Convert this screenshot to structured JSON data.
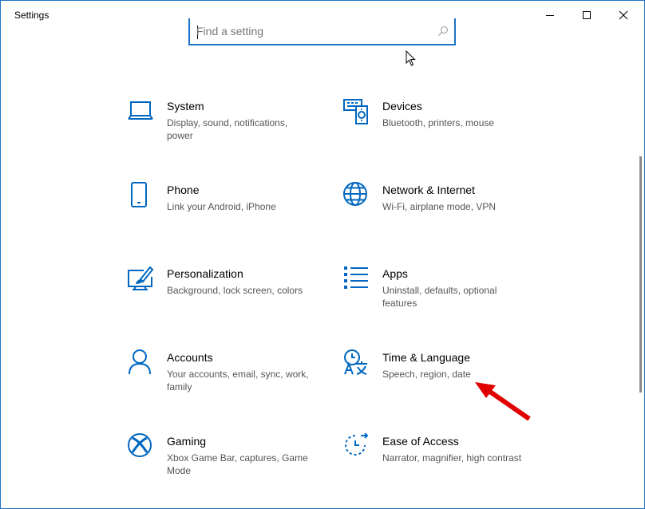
{
  "window": {
    "title": "Settings",
    "controls": {
      "minimize": "minimize",
      "maximize": "maximize",
      "close": "close"
    }
  },
  "search": {
    "placeholder": "Find a setting",
    "value": ""
  },
  "accent_color": "#0067c0",
  "annotation_color": "#e00000",
  "tiles": [
    {
      "title": "System",
      "description": "Display, sound, notifications, power",
      "icon": "laptop-icon"
    },
    {
      "title": "Devices",
      "description": "Bluetooth, printers, mouse",
      "icon": "devices-icon"
    },
    {
      "title": "Phone",
      "description": "Link your Android, iPhone",
      "icon": "phone-icon"
    },
    {
      "title": "Network & Internet",
      "description": "Wi-Fi, airplane mode, VPN",
      "icon": "globe-icon"
    },
    {
      "title": "Personalization",
      "description": "Background, lock screen, colors",
      "icon": "paintbrush-icon"
    },
    {
      "title": "Apps",
      "description": "Uninstall, defaults, optional features",
      "icon": "apps-list-icon"
    },
    {
      "title": "Accounts",
      "description": "Your accounts, email, sync, work, family",
      "icon": "person-icon"
    },
    {
      "title": "Time & Language",
      "description": "Speech, region, date",
      "icon": "time-language-icon"
    },
    {
      "title": "Gaming",
      "description": "Xbox Game Bar, captures, Game Mode",
      "icon": "xbox-icon"
    },
    {
      "title": "Ease of Access",
      "description": "Narrator, magnifier, high contrast",
      "icon": "ease-of-access-icon"
    }
  ]
}
